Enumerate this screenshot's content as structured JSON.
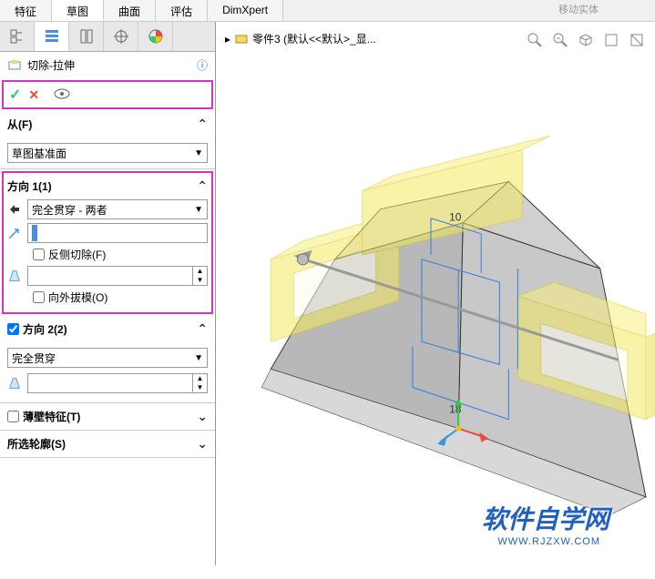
{
  "top_hint": "移动实体",
  "ribbon": {
    "tabs": [
      "特征",
      "草图",
      "曲面",
      "评估",
      "DimXpert"
    ],
    "active": 1
  },
  "breadcrumb": {
    "part": "零件3 (默认<<默认>_显..."
  },
  "feature": {
    "title": "切除-拉伸"
  },
  "from": {
    "label": "从(F)",
    "value": "草图基准面"
  },
  "direction1": {
    "label": "方向 1(1)",
    "end_condition": "完全贯穿 - 两者",
    "reverse_cut_label": "反侧切除(F)",
    "draft_outward_label": "向外拔模(O)"
  },
  "direction2": {
    "label": "方向 2(2)",
    "end_condition": "完全贯穿"
  },
  "thin_feature": {
    "label": "薄壁特征(T)"
  },
  "selected_contours": {
    "label": "所选轮廓(S)"
  },
  "dimensions": {
    "d1": "10",
    "d2": "18"
  },
  "watermark": {
    "text": "软件自学网",
    "url": "WWW.RJZXW.COM"
  }
}
